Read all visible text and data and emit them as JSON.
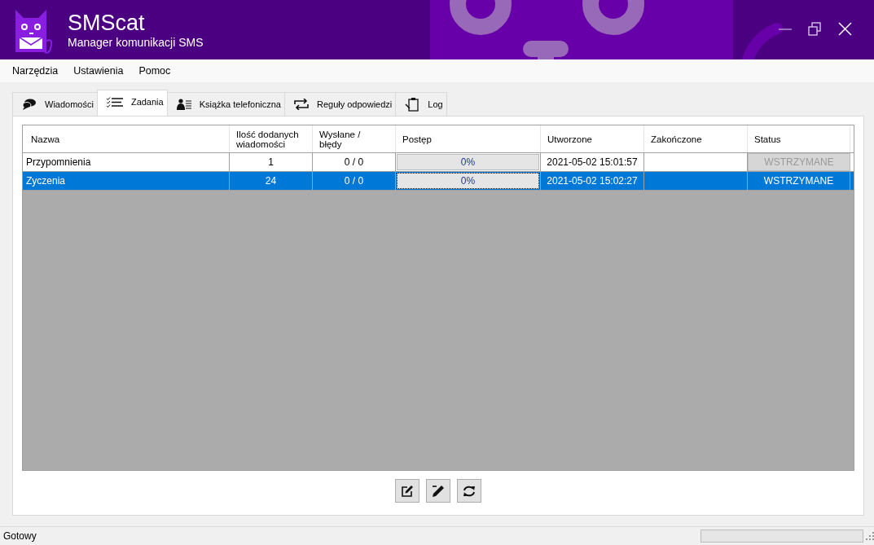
{
  "app": {
    "title": "SMScat",
    "subtitle": "Manager komunikacji SMS"
  },
  "menu": [
    {
      "label": "Narzędzia"
    },
    {
      "label": "Ustawienia"
    },
    {
      "label": "Pomoc"
    }
  ],
  "tabs": [
    {
      "label": "Wiadomości",
      "kind": "chat",
      "selected": false
    },
    {
      "label": "Zadania",
      "kind": "checklist",
      "selected": true
    },
    {
      "label": "Książka telefoniczna",
      "kind": "contacts",
      "selected": false
    },
    {
      "label": "Reguły odpowiedzi",
      "kind": "swap",
      "selected": false
    },
    {
      "label": "Log",
      "kind": "clipboard",
      "selected": false
    }
  ],
  "table": {
    "columns": [
      "Nazwa",
      "Ilość dodanych wiadomości",
      "Wysłane / błędy",
      "Postęp",
      "Utworzone",
      "Zakończone",
      "Status"
    ],
    "rows": [
      {
        "name": "Przypomnienia",
        "count": "1",
        "sent": "0 / 0",
        "progress": "0%",
        "level": 0,
        "created": "2021-05-02 15:01:57",
        "status": "WSTRZYMANE",
        "selected": false
      },
      {
        "name": "Zyczenia",
        "count": "24",
        "sent": "0 / 0",
        "progress": "0%",
        "level": 0,
        "created": "2021-05-02 15:02:27",
        "status": "WSTRZYMANE",
        "selected": true
      }
    ]
  },
  "toolbar": [
    {
      "kind": "edit"
    },
    {
      "kind": "pencil"
    },
    {
      "kind": "refresh"
    }
  ],
  "status_bar": {
    "text": "Gotowy",
    "level": 0
  }
}
